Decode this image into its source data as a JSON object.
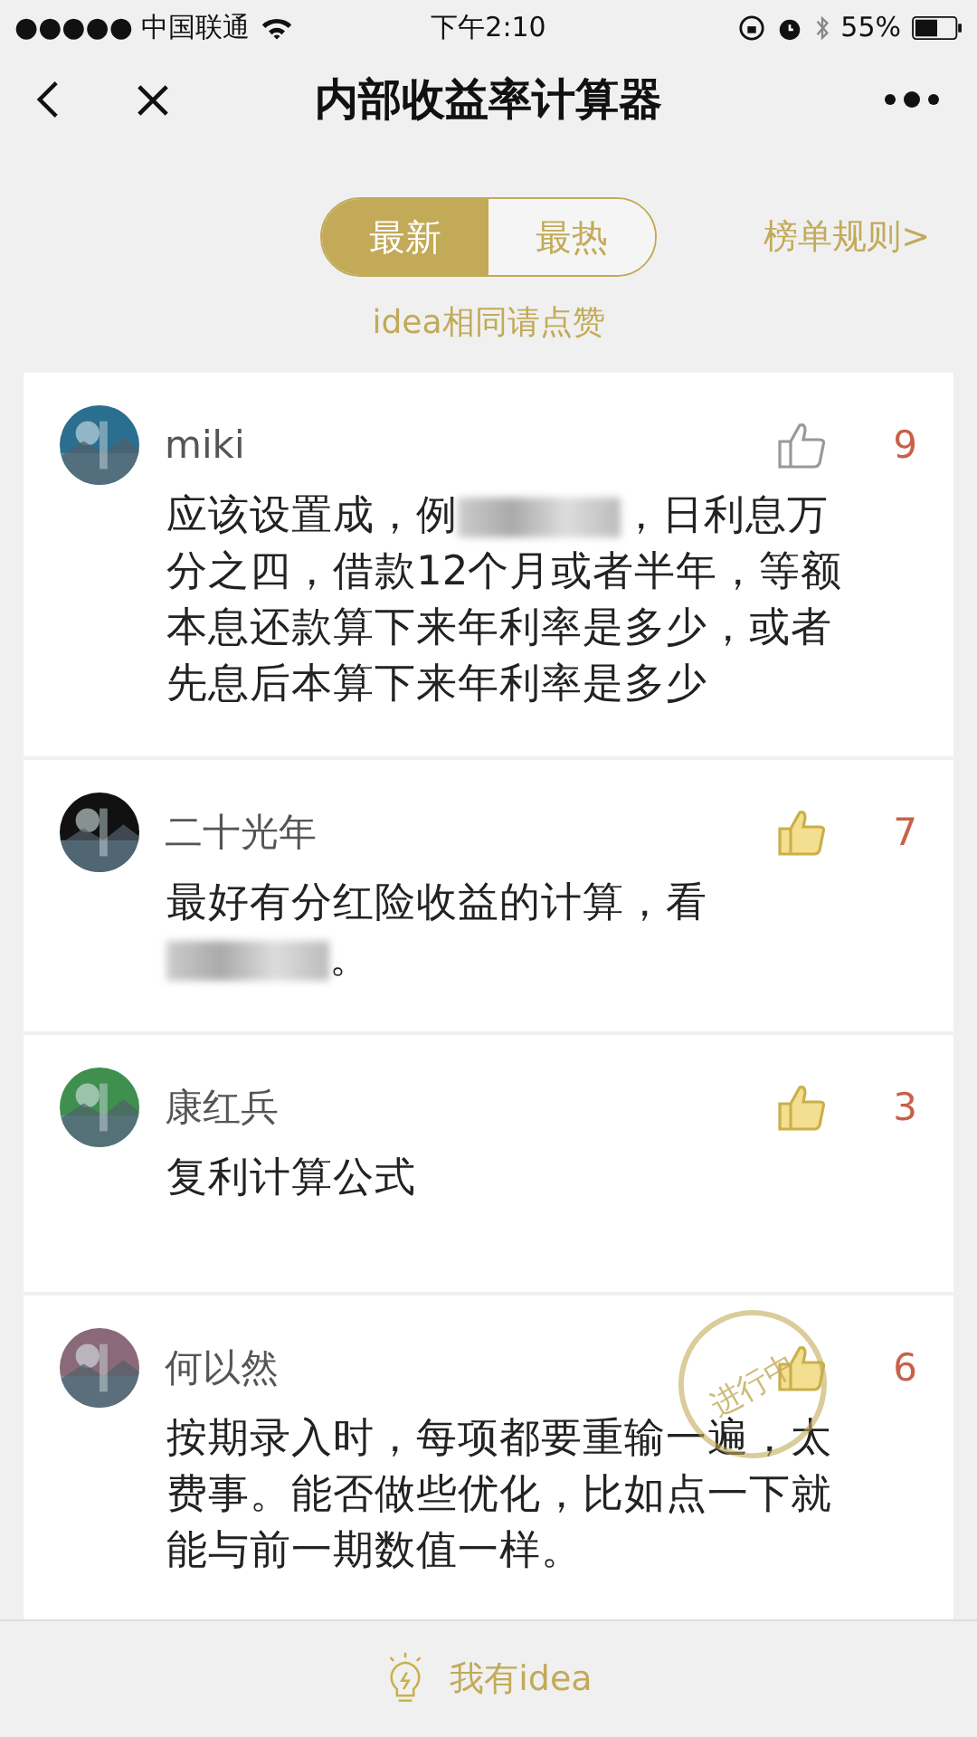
{
  "status_bar": {
    "carrier": "●●●●● 中国联通",
    "time": "下午2:10",
    "battery": "55%"
  },
  "nav": {
    "title": "内部收益率计算器"
  },
  "tabs": [
    {
      "label": "最新",
      "selected": true
    },
    {
      "label": "最热",
      "selected": false
    }
  ],
  "rules_link": "榜单规则>",
  "hint": "idea相同请点赞",
  "comments": [
    {
      "name": "miki",
      "liked": false,
      "likes": "9",
      "body": [
        {
          "kind": "text",
          "text": "应该设置成，例"
        },
        {
          "kind": "blurred"
        },
        {
          "kind": "text",
          "text": "，日利息万分之四，借款12个月或者半年，等额本息还款算下来年利率是多少，或者先息后本算下来年利率是多少"
        }
      ]
    },
    {
      "name": "二十光年",
      "liked": true,
      "likes": "7",
      "body": [
        {
          "kind": "text",
          "text": "最好有分红险收益的计算，看"
        },
        {
          "kind": "blurred"
        },
        {
          "kind": "text",
          "text": "。"
        }
      ]
    },
    {
      "name": "康红兵",
      "liked": true,
      "likes": "3",
      "body": [
        {
          "kind": "text",
          "text": "复利计算公式"
        }
      ]
    },
    {
      "name": "何以然",
      "liked": true,
      "likes": "6",
      "stamp": "进行中",
      "body": [
        {
          "kind": "text",
          "text": "按期录入时，每项都要重输一遍，太费事。能否做些优化，比如点一下就能与前一期数值一样。"
        }
      ]
    }
  ],
  "footer_button": "我有idea"
}
